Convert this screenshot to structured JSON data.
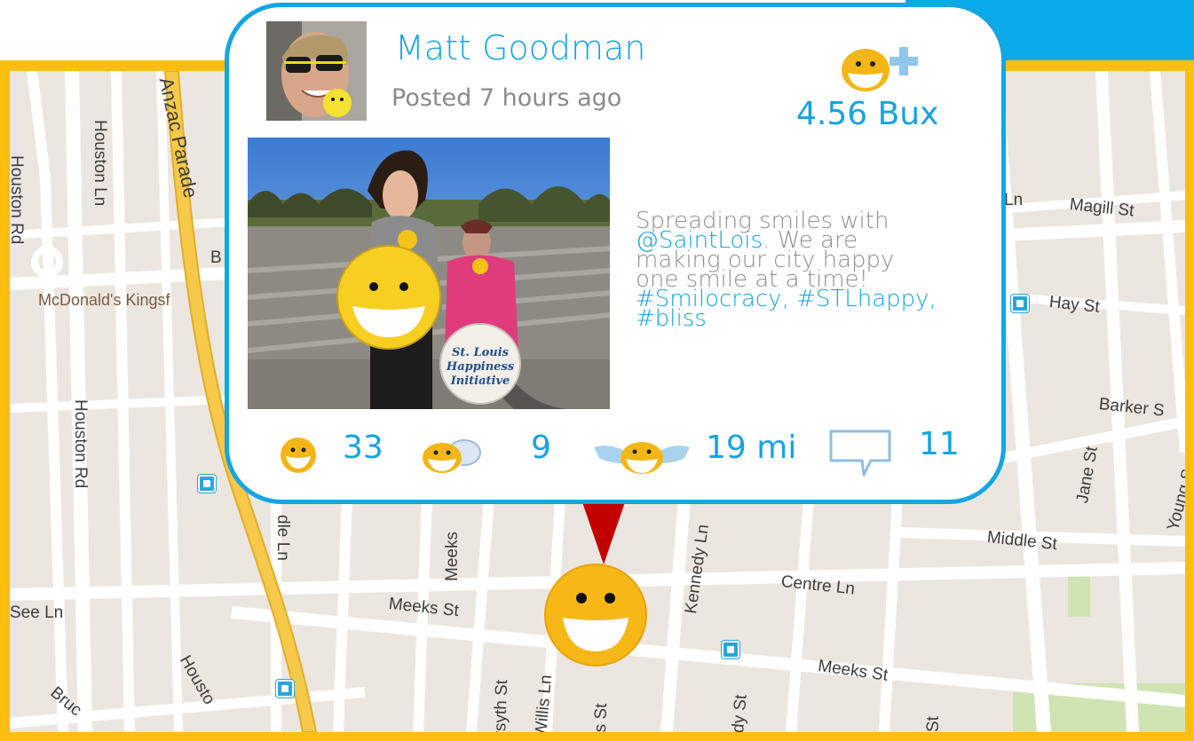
{
  "post": {
    "author": "Matt Goodman",
    "posted": "Posted 7 hours ago",
    "bux": "4.56 Bux",
    "caption": {
      "line1": "Spreading smiles with",
      "mention": "@SaintLois",
      "line2_rest": ".  We are",
      "line3": "making our city happy",
      "line4": "one smile at a time!",
      "hashtags1": "#Smilocracy, #STLhappy,",
      "hashtags2": "#bliss"
    },
    "sign_text": {
      "line1": "St. Louis",
      "line2": "Happiness",
      "line3": "Initiative"
    }
  },
  "stats": {
    "smiles": "33",
    "shares": "9",
    "distance": "19 mi",
    "comments": "11"
  },
  "icons": {
    "add_bux": "smiley-plus-icon",
    "smiles": "smiley-icon",
    "shares": "smiley-chat-icon",
    "distance": "winged-smiley-icon",
    "comments": "comment-bubble-icon",
    "pin": "smiley-pin-icon"
  },
  "colors": {
    "accent": "#14a4e0",
    "frame": "#fdbf0f",
    "pin": "#c20000",
    "smiley": "#f7b716"
  },
  "map": {
    "streets": {
      "houston_rd_top": "Houston Rd",
      "houston_ln": "Houston Ln",
      "anzac_parade": "Anzac Parade",
      "mcdonalds": "McDonald's Kingsf",
      "houston_rd_mid": "Houston Rd",
      "b_label": "B",
      "dle_ln": "dle Ln",
      "see_ln": "See Ln",
      "houston_bottom": "Housto",
      "bruce": "Bruc",
      "meeks_vert": "Meeks",
      "meeks_st_left": "Meeks St",
      "forsyth": "rsyth St",
      "willis": "Willis Ln",
      "s_st": "s St",
      "kennedy": "Kennedy Ln",
      "dy_st": "dy St",
      "centre_ln": "Centre Ln",
      "meeks_st_right": "Meeks St",
      "st_stub": "St",
      "ln_stub": "Ln",
      "magill": "Magill St",
      "hay": "Hay St",
      "barker": "Barker S",
      "jane": "Jane St",
      "young": "Young S",
      "middle": "Middle St"
    }
  }
}
